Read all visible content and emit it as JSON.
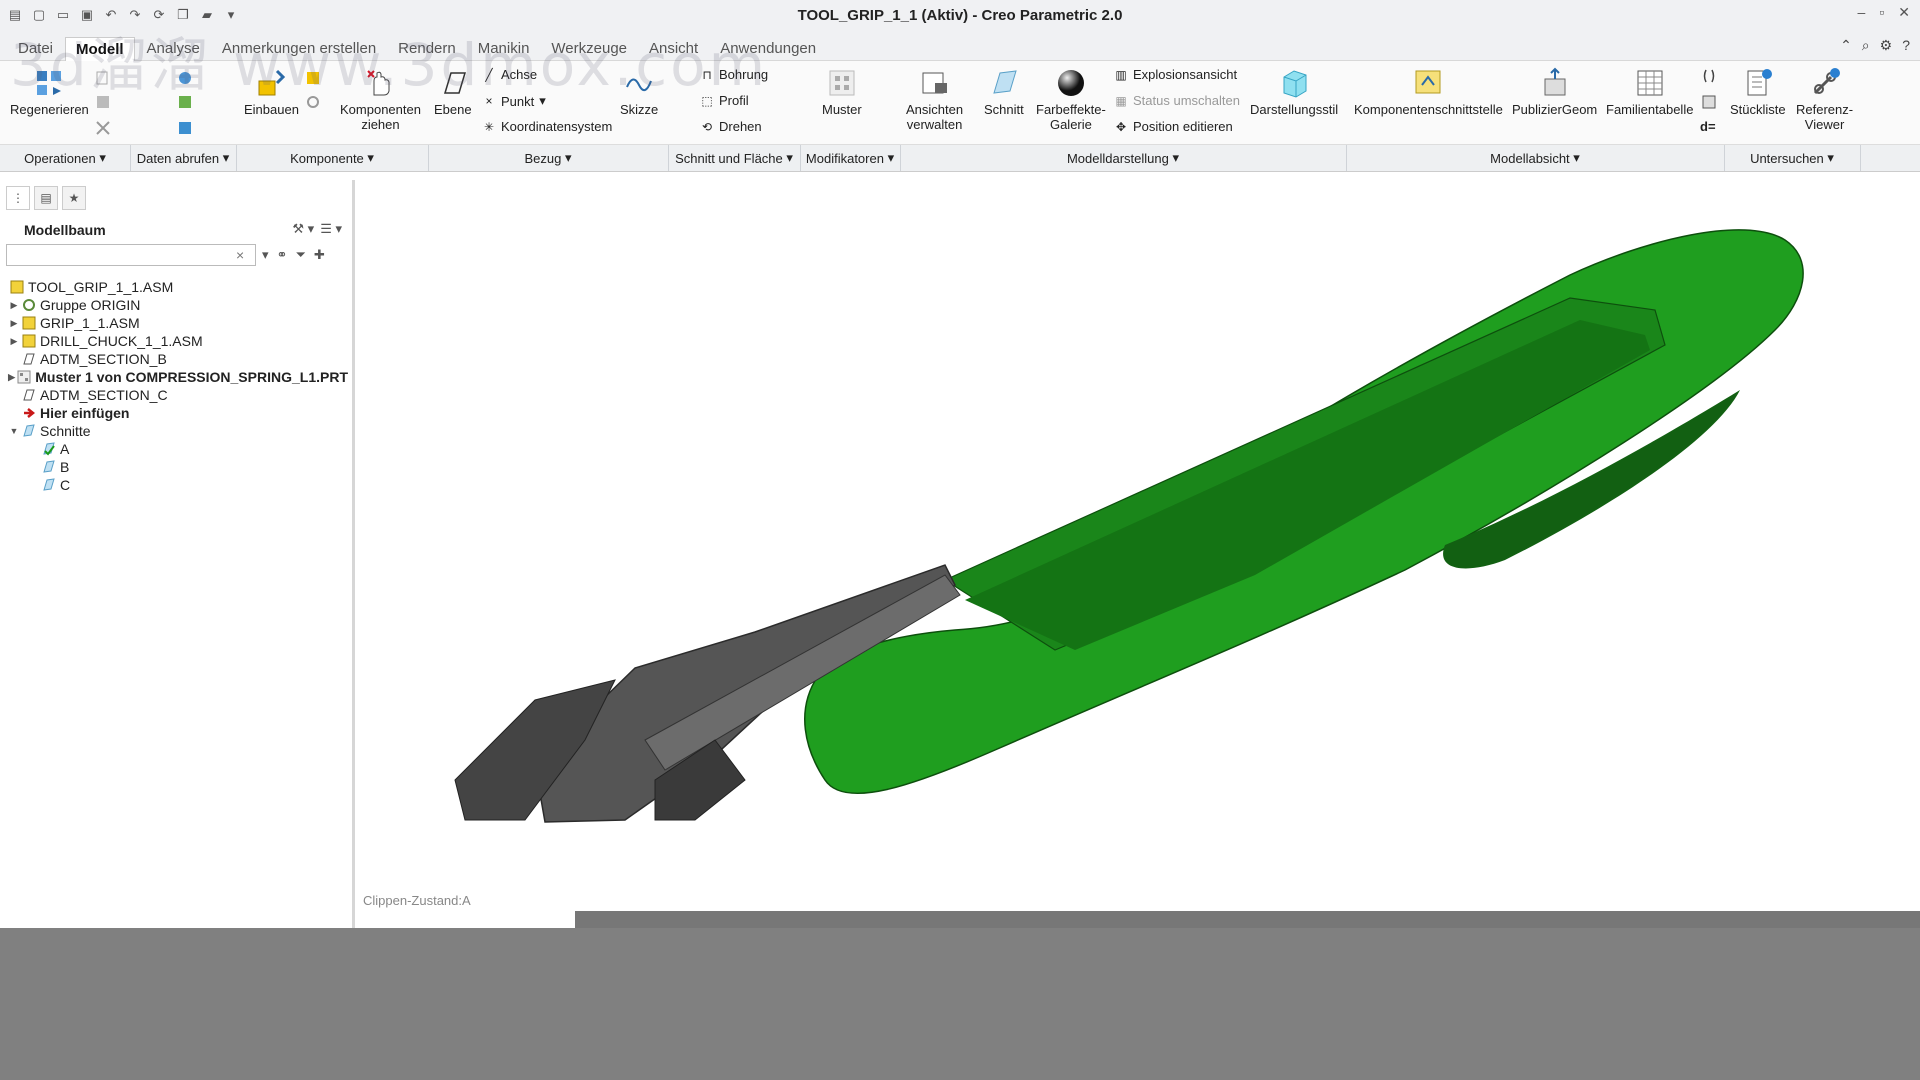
{
  "window": {
    "title": "TOOL_GRIP_1_1 (Aktiv) - Creo Parametric 2.0"
  },
  "watermark": {
    "text": "3d溜溜 www.3dmox.com"
  },
  "tabs": [
    {
      "label": "Datei"
    },
    {
      "label": "Modell"
    },
    {
      "label": "Analyse"
    },
    {
      "label": "Anmerkungen erstellen"
    },
    {
      "label": "Rendern"
    },
    {
      "label": "Manikin"
    },
    {
      "label": "Werkzeuge"
    },
    {
      "label": "Ansicht"
    },
    {
      "label": "Anwendungen"
    }
  ],
  "ribbon": {
    "regenerieren": "Regenerieren",
    "einbauen": "Einbauen",
    "komponenten_ziehen_1": "Komponenten",
    "komponenten_ziehen_2": "ziehen",
    "ebene": "Ebene",
    "achse": "Achse",
    "punkt": "Punkt",
    "koordinatensystem": "Koordinatensystem",
    "skizze": "Skizze",
    "bohrung": "Bohrung",
    "profil": "Profil",
    "drehen": "Drehen",
    "muster": "Muster",
    "ansichten_verwalten_1": "Ansichten",
    "ansichten_verwalten_2": "verwalten",
    "schnitt": "Schnitt",
    "farbeffekte_1": "Farbeffekte-",
    "farbeffekte_2": "Galerie",
    "explosionsansicht": "Explosionsansicht",
    "status_umschalten": "Status umschalten",
    "position_editieren": "Position editieren",
    "darstellungsstil": "Darstellungsstil",
    "komponentenschnittstelle": "Komponentenschnittstelle",
    "publiziergeom": "PublizierGeom",
    "familientabelle": "Familientabelle",
    "d_equals": "d=",
    "stueckliste": "Stückliste",
    "referenz_viewer_1": "Referenz-",
    "referenz_viewer_2": "Viewer"
  },
  "groups": [
    {
      "label": "Operationen"
    },
    {
      "label": "Daten abrufen"
    },
    {
      "label": "Komponente"
    },
    {
      "label": "Bezug"
    },
    {
      "label": "Schnitt und Fläche"
    },
    {
      "label": "Modifikatoren"
    },
    {
      "label": "Modelldarstellung"
    },
    {
      "label": "Modellabsicht"
    },
    {
      "label": "Untersuchen"
    }
  ],
  "model_tree": {
    "title": "Modellbaum",
    "search_placeholder": "",
    "items": [
      {
        "label": "TOOL_GRIP_1_1.ASM"
      },
      {
        "label": "Gruppe ORIGIN"
      },
      {
        "label": "GRIP_1_1.ASM"
      },
      {
        "label": "DRILL_CHUCK_1_1.ASM"
      },
      {
        "label": "ADTM_SECTION_B"
      },
      {
        "label": "Muster 1 von COMPRESSION_SPRING_L1.PRT"
      },
      {
        "label": "ADTM_SECTION_C"
      },
      {
        "label": "Hier einfügen"
      },
      {
        "label": "Schnitte"
      },
      {
        "label": "A"
      },
      {
        "label": "B"
      },
      {
        "label": "C"
      }
    ]
  },
  "viewport": {
    "clip_label": "Clippen-Zustand:A",
    "colors": {
      "grip_green": "#1f9e1f",
      "grip_dark": "#146e14",
      "chuck_gray": "#555555"
    }
  }
}
